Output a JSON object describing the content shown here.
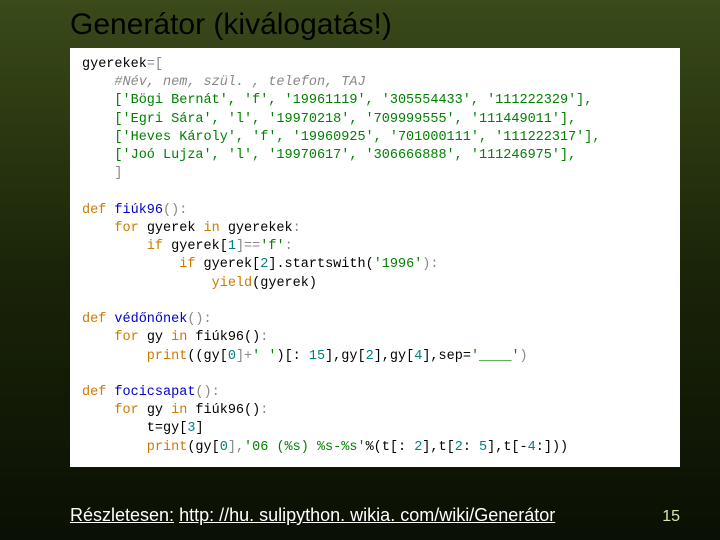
{
  "title": "Generátor (kiválogatás!)",
  "code": {
    "l01a": "gyerekek",
    "l01b": "=[",
    "l02": "    #Név, nem, szül. , telefon, TAJ",
    "l03": "    ['Bögi Bernát', 'f', '19961119', '305554433', '111222329'],",
    "l04": "    ['Egri Sára', 'l', '19970218', '709999555', '111449011'],",
    "l05": "    ['Heves Károly', 'f', '19960925', '701000111', '111222317'],",
    "l06": "    ['Joó Lujza', 'l', '19970617', '306666888', '111246975'],",
    "l07": "    ]",
    "def": "def ",
    "fn1": "fiúk96",
    "paren": "():",
    "for": "    for ",
    "in": " in ",
    "colon": ":",
    "gyerek": "gyerek",
    "gyerekek": "gyerekek",
    "if": "        if ",
    "ifinner": "            if ",
    "cond1a": "gyerek[",
    "idx1": "1",
    "cond1b": "]==",
    "strf": "'f'",
    "cond2a": "gyerek[",
    "idx2": "2",
    "cond2b": "].startswith(",
    "str1996": "'1996'",
    "cond2c": "):",
    "yield": "                yield",
    "yieldarg": "(gyerek)",
    "fn2": "védőnőnek",
    "gy": "gy",
    "fiuk96call": "fiúk96()",
    "print": "        print",
    "p2a": "((gy[",
    "idx0": "0",
    "p2b": "]+",
    "strsp": "' '",
    "p2c": ")[: ",
    "n15": "15",
    "p2d": "],gy[",
    "p2e": "],gy[",
    "idx4": "4",
    "p2f": "],sep=",
    "strsep": "'____'",
    "p2g": ")",
    "fn3": "focicsapat",
    "tassign_a": "        t=gy[",
    "idx3": "3",
    "tassign_b": "]",
    "p3a": "(gy[",
    "p3b": "],",
    "str06": "'06 (%s) %s-%s'",
    "p3c": "%(t[: ",
    "n2": "2",
    "p3d": "],t[",
    "p3e": ": ",
    "n5": "5",
    "p3f": "],t[-",
    "p3g": ":]))"
  },
  "footer": {
    "label": "Részletesen:",
    "url_text": "http: //hu. sulipython. wikia. com/wiki/Generátor",
    "pagenum": "15"
  }
}
